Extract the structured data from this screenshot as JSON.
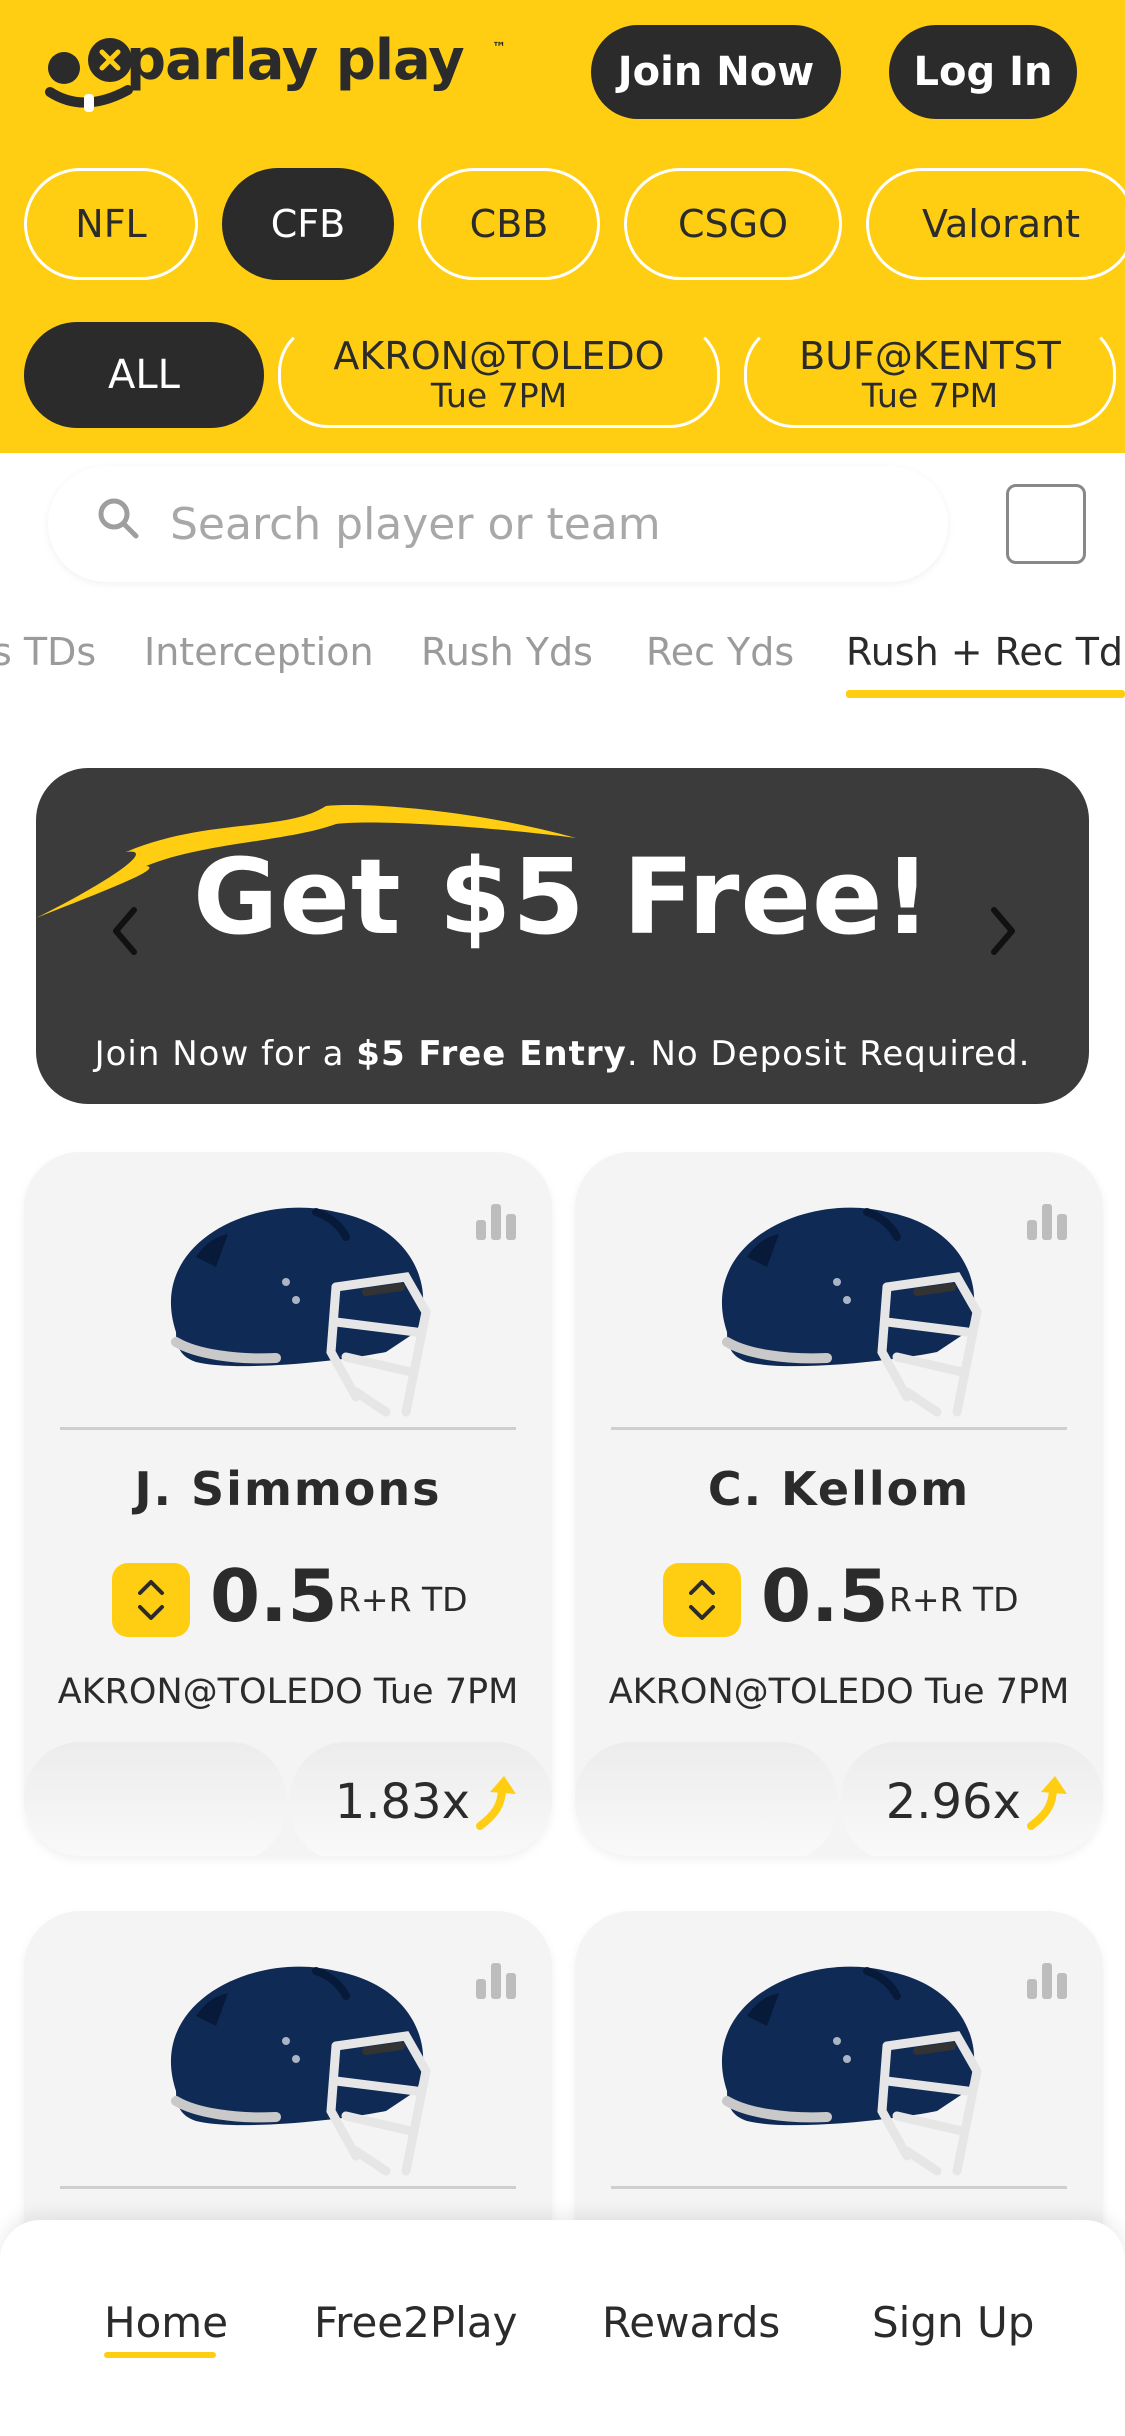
{
  "header": {
    "logo_text": "parlay play",
    "logo_tm": "™",
    "join_label": "Join Now",
    "login_label": "Log In"
  },
  "sports": [
    {
      "label": "NFL",
      "active": false
    },
    {
      "label": "CFB",
      "active": true
    },
    {
      "label": "CBB",
      "active": false
    },
    {
      "label": "CSGO",
      "active": false
    },
    {
      "label": "Valorant",
      "active": false
    }
  ],
  "games": {
    "all_label": "ALL",
    "items": [
      {
        "name": "AKRON@TOLEDO",
        "time": "Tue 7PM"
      },
      {
        "name": "BUF@KENTST",
        "time": "Tue 7PM"
      }
    ]
  },
  "search": {
    "placeholder": "Search player or team"
  },
  "stat_tabs": [
    "s TDs",
    "Interception",
    "Rush Yds",
    "Rec Yds",
    "Rush + Rec Td"
  ],
  "stat_tabs_active": "Rush + Rec Td",
  "promo": {
    "title": "Get $5 Free!",
    "sub_prefix": "Join Now for a ",
    "sub_bold": "$5 Free Entry",
    "sub_suffix": ". No Deposit Required."
  },
  "cards": [
    {
      "player": "J. Simmons",
      "line": "0.5",
      "stat": "R+R TD",
      "game": "AKRON@TOLEDO Tue 7PM",
      "multiplier": "1.83x"
    },
    {
      "player": "C. Kellom",
      "line": "0.5",
      "stat": "R+R TD",
      "game": "AKRON@TOLEDO Tue 7PM",
      "multiplier": "2.96x"
    }
  ],
  "nav": [
    "Home",
    "Free2Play",
    "Rewards",
    "Sign Up"
  ],
  "nav_active": "Home",
  "colors": {
    "brand_yellow": "#FFCE12",
    "dark": "#2B2B2B",
    "helmet_navy": "#0F2A55"
  }
}
